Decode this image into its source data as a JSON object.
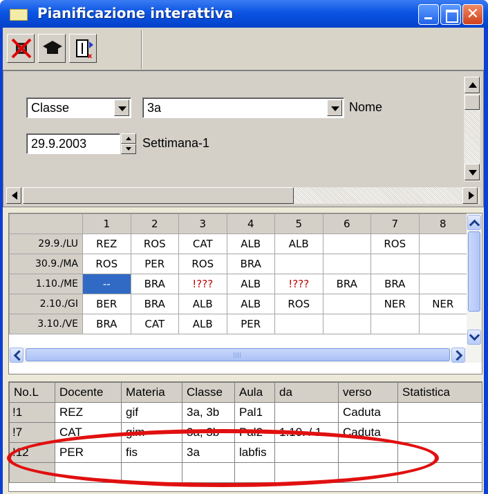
{
  "window": {
    "title": "Pianificazione interattiva",
    "close_glyph": "✕"
  },
  "toolbar": {
    "icons": [
      "delete-icon",
      "graduation-cap-icon",
      "exit-door-icon"
    ]
  },
  "form": {
    "type_value": "Classe",
    "class_value": "3a",
    "name_label": "Nome",
    "date_value": "29.9.2003",
    "week_label": "Settimana-1"
  },
  "grid": {
    "columns": [
      "",
      "1",
      "2",
      "3",
      "4",
      "5",
      "6",
      "7",
      "8"
    ],
    "rows": [
      {
        "day": "29.9./LU",
        "cells": [
          "REZ",
          "ROS",
          "CAT",
          "ALB",
          "ALB",
          "",
          "ROS",
          ""
        ]
      },
      {
        "day": "30.9./MA",
        "cells": [
          "ROS",
          "PER",
          "ROS",
          "BRA",
          "",
          "",
          "",
          ""
        ]
      },
      {
        "day": "1.10./ME",
        "cells": [
          "--",
          "BRA",
          "!???",
          "ALB",
          "!???",
          "BRA",
          "BRA",
          ""
        ]
      },
      {
        "day": "2.10./GI",
        "cells": [
          "BER",
          "BRA",
          "ALB",
          "ALB",
          "ROS",
          "",
          "NER",
          "NER"
        ]
      },
      {
        "day": "3.10./VE",
        "cells": [
          "BRA",
          "CAT",
          "ALB",
          "PER",
          "",
          "",
          "",
          ""
        ]
      }
    ]
  },
  "list": {
    "headers": [
      "No.L",
      "Docente",
      "Materia",
      "Classe",
      "Aula",
      "da",
      "verso",
      "Statistica"
    ],
    "rows": [
      [
        "!1",
        "REZ",
        "gif",
        "3a, 3b",
        "Pal1",
        "",
        "Caduta",
        ""
      ],
      [
        "!7",
        "CAT",
        "gim",
        "3a, 3b",
        "Pal2",
        "1.10. / 1",
        "Caduta",
        ""
      ],
      [
        "!12",
        "PER",
        "fis",
        "3a",
        "labfis",
        "",
        "",
        ""
      ],
      [
        "",
        "",
        "",
        "",
        "",
        "",
        "",
        ""
      ]
    ]
  },
  "colors": {
    "annotation": "#e11010",
    "selection": "#316ac5",
    "title_bar": "#0a55e3"
  }
}
